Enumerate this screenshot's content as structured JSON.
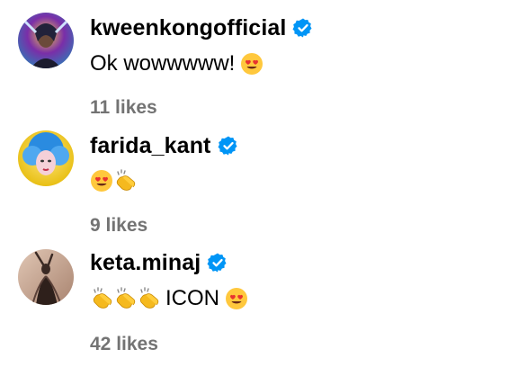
{
  "comments": [
    {
      "username": "kweenkongofficial",
      "verified": true,
      "text": "Ok wowwwww!",
      "emojis_after": [
        "heart-eyes-emoji"
      ],
      "likes": "11 likes",
      "avatar_colors": [
        "#3a6fb5",
        "#7a2ea8",
        "#f2c94c"
      ]
    },
    {
      "username": "farida_kant",
      "verified": true,
      "text": "",
      "emojis_after": [
        "heart-eyes-emoji",
        "clapping-hands-emoji"
      ],
      "likes": "9 likes",
      "avatar_colors": [
        "#2a8be0",
        "#f5d0d8",
        "#e4b800"
      ]
    },
    {
      "username": "keta.minaj",
      "verified": true,
      "text": "ICON",
      "emojis_before": [
        "clapping-hands-emoji",
        "clapping-hands-emoji",
        "clapping-hands-emoji"
      ],
      "emojis_after": [
        "heart-eyes-emoji"
      ],
      "likes": "42 likes",
      "avatar_colors": [
        "#c9a891",
        "#3b2a24",
        "#8a6a58"
      ]
    }
  ],
  "colors": {
    "verified_blue": "#0095f6",
    "likes_gray": "#737373",
    "text": "#000000"
  }
}
